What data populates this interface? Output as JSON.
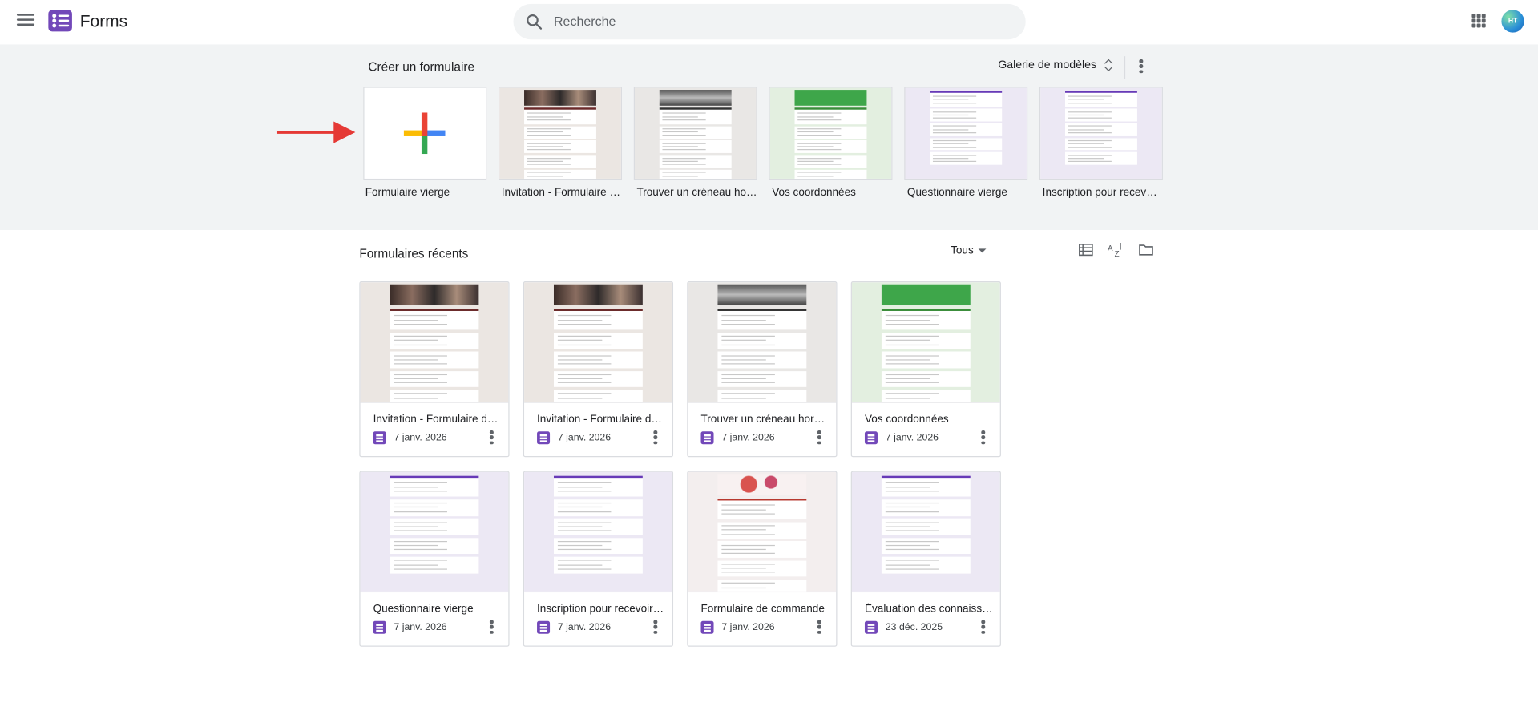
{
  "header": {
    "app_title": "Forms",
    "search_placeholder": "Recherche",
    "avatar_initials": "HT"
  },
  "create": {
    "title": "Créer un formulaire",
    "gallery_label": "Galerie de modèles",
    "templates": [
      {
        "label": "Formulaire vierge",
        "theme": "blank"
      },
      {
        "label": "Invitation - Formulaire de réponse",
        "theme": "party"
      },
      {
        "label": "Trouver un créneau horaire",
        "theme": "pen"
      },
      {
        "label": "Vos coordonnées",
        "theme": "green"
      },
      {
        "label": "Questionnaire vierge",
        "theme": "purple"
      },
      {
        "label": "Inscription pour recevoir un t-shirt",
        "theme": "tshirt"
      }
    ]
  },
  "recent": {
    "title": "Formulaires récents",
    "filter_label": "Tous",
    "forms": [
      {
        "title": "Invitation - Formulaire de réponse",
        "date": "7 janv. 2026",
        "theme": "party"
      },
      {
        "title": "Invitation - Formulaire de réponse",
        "date": "7 janv. 2026",
        "theme": "party"
      },
      {
        "title": "Trouver un créneau horaire",
        "date": "7 janv. 2026",
        "theme": "pen"
      },
      {
        "title": "Vos coordonnées",
        "date": "7 janv. 2026",
        "theme": "green"
      },
      {
        "title": "Questionnaire vierge",
        "date": "7 janv. 2026",
        "theme": "purple"
      },
      {
        "title": "Inscription pour recevoir un t-shirt",
        "date": "7 janv. 2026",
        "theme": "tshirt"
      },
      {
        "title": "Formulaire de commande",
        "date": "7 janv. 2026",
        "theme": "flowers"
      },
      {
        "title": "Évaluation des connaissances marketing",
        "date": "23 déc. 2025",
        "theme": "purple2"
      }
    ]
  },
  "colors": {
    "forms_purple": "#7248b9",
    "arrow_red": "#e53935",
    "band_bg": "#f1f3f4"
  },
  "icons": [
    "menu-icon",
    "forms-logo-icon",
    "search-icon",
    "apps-grid-icon",
    "sort-updown-icon",
    "more-vert-icon",
    "list-view-icon",
    "sort-az-icon",
    "folder-icon",
    "forms-file-icon"
  ]
}
